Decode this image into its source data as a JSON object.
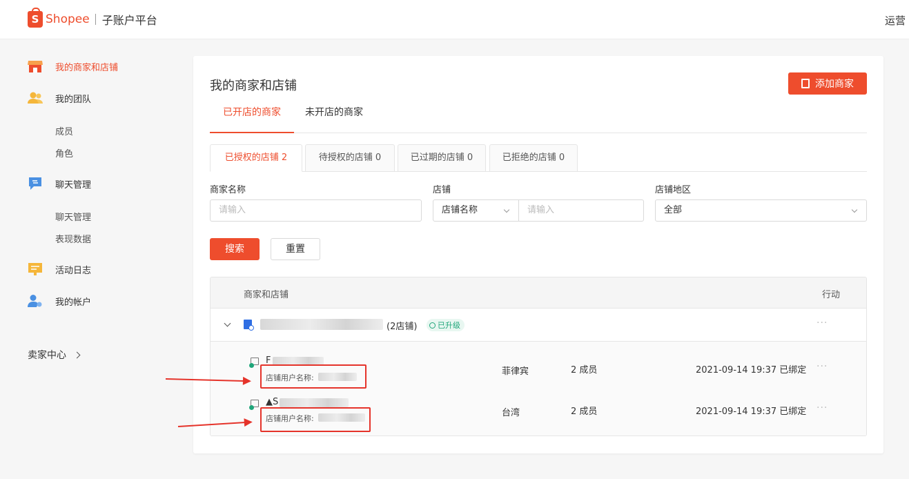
{
  "header": {
    "logo_text": "Shopee",
    "platform": "子账户平台",
    "user": "运营"
  },
  "sidebar": {
    "items": [
      {
        "label": "我的商家和店铺",
        "icon": "store-icon"
      },
      {
        "label": "我的团队",
        "icon": "team-icon"
      },
      {
        "label": "成员"
      },
      {
        "label": "角色"
      },
      {
        "label": "聊天管理",
        "icon": "chat-icon"
      },
      {
        "label": "聊天管理"
      },
      {
        "label": "表现数据"
      },
      {
        "label": "活动日志",
        "icon": "activity-log-icon"
      },
      {
        "label": "我的帐户",
        "icon": "account-icon"
      }
    ],
    "seller_center": "卖家中心"
  },
  "main": {
    "title": "我的商家和店铺",
    "add_button": "添加商家",
    "tabs": [
      "已开店的商家",
      "未开店的商家"
    ],
    "sub_tabs": [
      "已授权的店铺 2",
      "待授权的店铺 0",
      "已过期的店铺 0",
      "已拒绝的店铺 0"
    ],
    "filters": {
      "merchant_label": "商家名称",
      "merchant_placeholder": "请输入",
      "shop_label": "店铺",
      "shop_select": "店铺名称",
      "shop_placeholder": "请输入",
      "region_label": "店铺地区",
      "region_value": "全部"
    },
    "search_button": "搜索",
    "reset_button": "重置",
    "table": {
      "col_merchant": "商家和店铺",
      "col_action": "行动",
      "merchant": {
        "shop_count": "(2店铺)",
        "badge": "已升级",
        "more": "···"
      },
      "shops": [
        {
          "title_start": "F",
          "user_label": "店铺用户名称:",
          "region": "菲律宾",
          "members": "2 成员",
          "bound": "2021-09-14 19:37 已绑定",
          "more": "···"
        },
        {
          "title_start": "▲S",
          "user_label": "店铺用户名称:",
          "region": "台湾",
          "members": "2 成员",
          "bound": "2021-09-14 19:37 已绑定",
          "more": "···"
        }
      ]
    }
  },
  "colors": {
    "brand": "#ee4d2d",
    "badge_green": "#1fa67a",
    "annotation_red": "#e5332a"
  }
}
